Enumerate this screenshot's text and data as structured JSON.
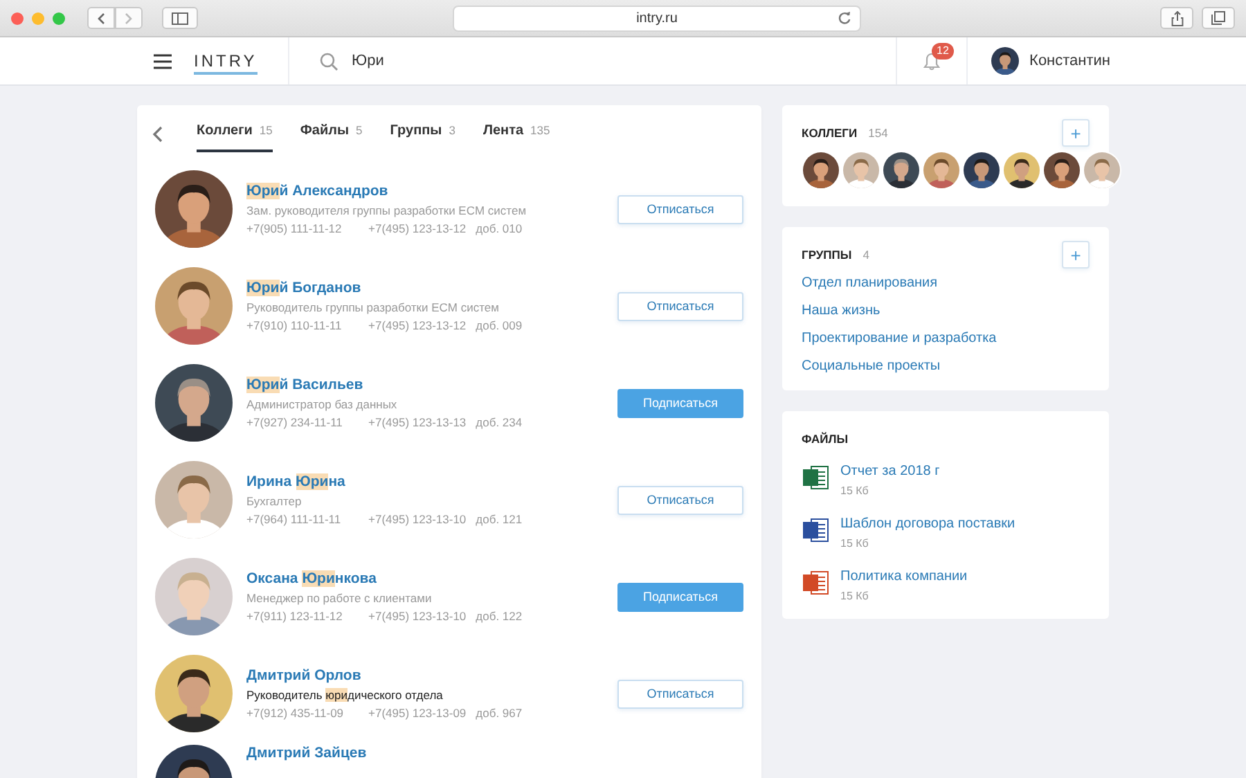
{
  "browser": {
    "address": "intry.ru"
  },
  "header": {
    "logo": "INTRY",
    "search": {
      "value": "Юри"
    },
    "notifications": "12",
    "user": "Константин"
  },
  "tabs": [
    {
      "label": "Коллеги",
      "count": "15",
      "selected": true
    },
    {
      "label": "Файлы",
      "count": "5",
      "selected": false
    },
    {
      "label": "Группы",
      "count": "3",
      "selected": false
    },
    {
      "label": "Лента",
      "count": "135",
      "selected": false
    }
  ],
  "people": [
    {
      "name": [
        {
          "text": "Юри",
          "match": true
        },
        {
          "text": "й Александров",
          "match": false
        }
      ],
      "position": [
        {
          "text": "Зам. руководителя группы разработки ECM систем",
          "match": false
        }
      ],
      "mobile": "+7(905) 111-11-12",
      "phone": "+7(495) 123-13-12",
      "ext": "доб. 010",
      "subscribed": true,
      "button": "Отписаться"
    },
    {
      "name": [
        {
          "text": "Юри",
          "match": true
        },
        {
          "text": "й Богданов",
          "match": false
        }
      ],
      "position": [
        {
          "text": "Руководитель группы разработки ECM систем",
          "match": false
        }
      ],
      "mobile": "+7(910) 110-11-11",
      "phone": "+7(495) 123-13-12",
      "ext": "доб. 009",
      "subscribed": true,
      "button": "Отписаться"
    },
    {
      "name": [
        {
          "text": "Юри",
          "match": true
        },
        {
          "text": "й Васильев",
          "match": false
        }
      ],
      "position": [
        {
          "text": "Администратор баз данных",
          "match": false
        }
      ],
      "mobile": "+7(927) 234-11-11",
      "phone": "+7(495) 123-13-13",
      "ext": "доб. 234",
      "subscribed": false,
      "button": "Подписаться"
    },
    {
      "name": [
        {
          "text": "Ирина ",
          "match": false
        },
        {
          "text": "Юри",
          "match": true
        },
        {
          "text": "на",
          "match": false
        }
      ],
      "position": [
        {
          "text": "Бухгалтер",
          "match": false
        }
      ],
      "mobile": "+7(964) 111-11-11",
      "phone": "+7(495) 123-13-10",
      "ext": "доб. 121",
      "subscribed": true,
      "button": "Отписаться"
    },
    {
      "name": [
        {
          "text": "Оксана ",
          "match": false
        },
        {
          "text": "Юри",
          "match": true
        },
        {
          "text": "нкова",
          "match": false
        }
      ],
      "position": [
        {
          "text": "Менеджер по работе с клиентами",
          "match": false
        }
      ],
      "mobile": "+7(911) 123-11-12",
      "phone": "+7(495) 123-13-10",
      "ext": "доб. 122",
      "subscribed": false,
      "button": "Подписаться"
    },
    {
      "name": [
        {
          "text": "Дмитрий Орлов",
          "match": false
        }
      ],
      "position": [
        {
          "text": "Руководитель ",
          "match": false
        },
        {
          "text": "юри",
          "match": true
        },
        {
          "text": "дического отдела",
          "match": false
        }
      ],
      "mobile": "+7(912) 435-11-09",
      "phone": "+7(495) 123-13-09",
      "ext": "доб. 967",
      "subscribed": true,
      "button": "Отписаться"
    },
    {
      "name": [
        {
          "text": "Дмитрий Зайцев",
          "match": false
        }
      ]
    }
  ],
  "colleagues": {
    "title": "КОЛЛЕГИ",
    "count": "154",
    "add": "+"
  },
  "groups": {
    "title": "ГРУППЫ",
    "count": "4",
    "add": "+",
    "items": [
      "Отдел планирования",
      "Наша жизнь",
      "Проектирование и разработка",
      "Социальные проекты"
    ]
  },
  "files": {
    "title": "ФАЙЛЫ",
    "items": [
      {
        "name": "Отчет за 2018 г",
        "size": "15 Кб",
        "kind": "spreadsheet"
      },
      {
        "name": "Шаблон договора поставки",
        "size": "15 Кб",
        "kind": "document"
      },
      {
        "name": "Политика компании",
        "size": "15 Кб",
        "kind": "presentation"
      }
    ]
  }
}
